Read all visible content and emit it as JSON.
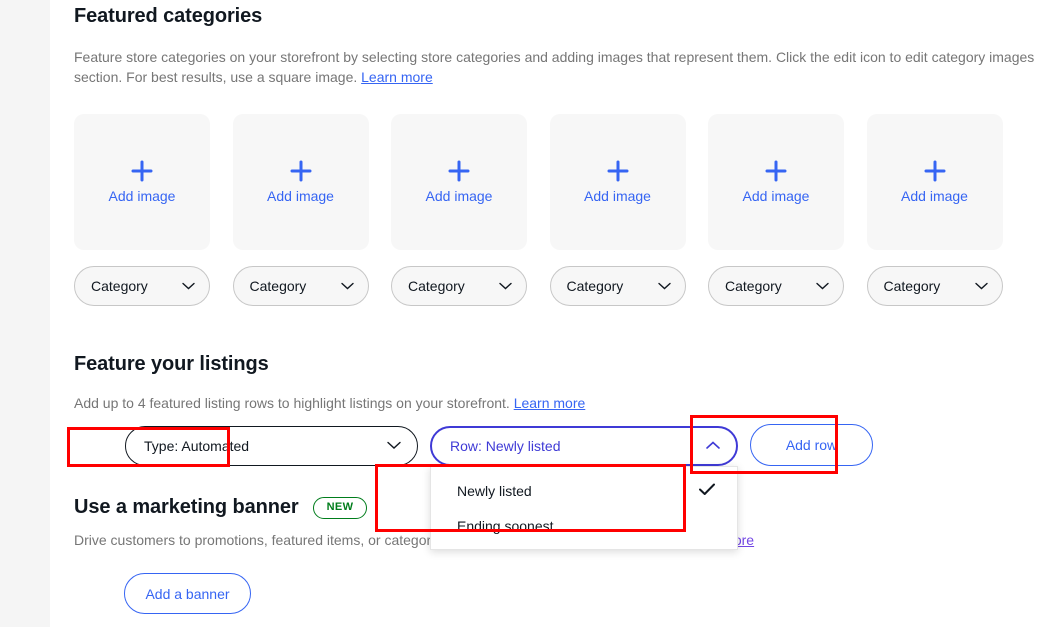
{
  "featured_categories": {
    "title": "Featured categories",
    "description_pre": "Feature store categories on your storefront by selecting store categories and adding images that represent them. Click the edit icon to edit category images section. For best results, use a square image. ",
    "learn_more": "Learn more",
    "cards": [
      {
        "add_image_label": "Add image",
        "category_label": "Category"
      },
      {
        "add_image_label": "Add image",
        "category_label": "Category"
      },
      {
        "add_image_label": "Add image",
        "category_label": "Category"
      },
      {
        "add_image_label": "Add image",
        "category_label": "Category"
      },
      {
        "add_image_label": "Add image",
        "category_label": "Category"
      },
      {
        "add_image_label": "Add image",
        "category_label": "Category"
      }
    ]
  },
  "feature_listings": {
    "title": "Feature your listings",
    "description_pre": "Add up to 4 featured listing rows to highlight listings on your storefront. ",
    "learn_more": "Learn more",
    "type_select": {
      "value": "Type: Automated",
      "chevron": "chevron-down-icon"
    },
    "row_select": {
      "value": "Row: Newly listed",
      "chevron": "chevron-up-icon"
    },
    "row_dropdown_options": [
      {
        "label": "Newly listed",
        "selected": true,
        "check": "check-icon"
      },
      {
        "label": "Ending soonest",
        "selected": false,
        "check": ""
      }
    ],
    "add_row_label": "Add row"
  },
  "marketing_banner": {
    "title": "Use a marketing banner",
    "badge": "NEW",
    "description_pre": "Drive customers to promotions, featured items, or categories in your store with a clickable banner. ",
    "learn_more": "Learn more",
    "add_banner_label": "Add a banner"
  },
  "colors": {
    "accent_blue": "#3665f3",
    "focus_purple": "#3f3ad6",
    "visited_link": "#7346e5",
    "badge_green": "#007d1b",
    "annotation_red": "#ff0000",
    "text_primary": "#111820",
    "text_secondary": "#767676",
    "tile_bg": "#f7f7f7",
    "page_bg": "#f5f5f5"
  }
}
